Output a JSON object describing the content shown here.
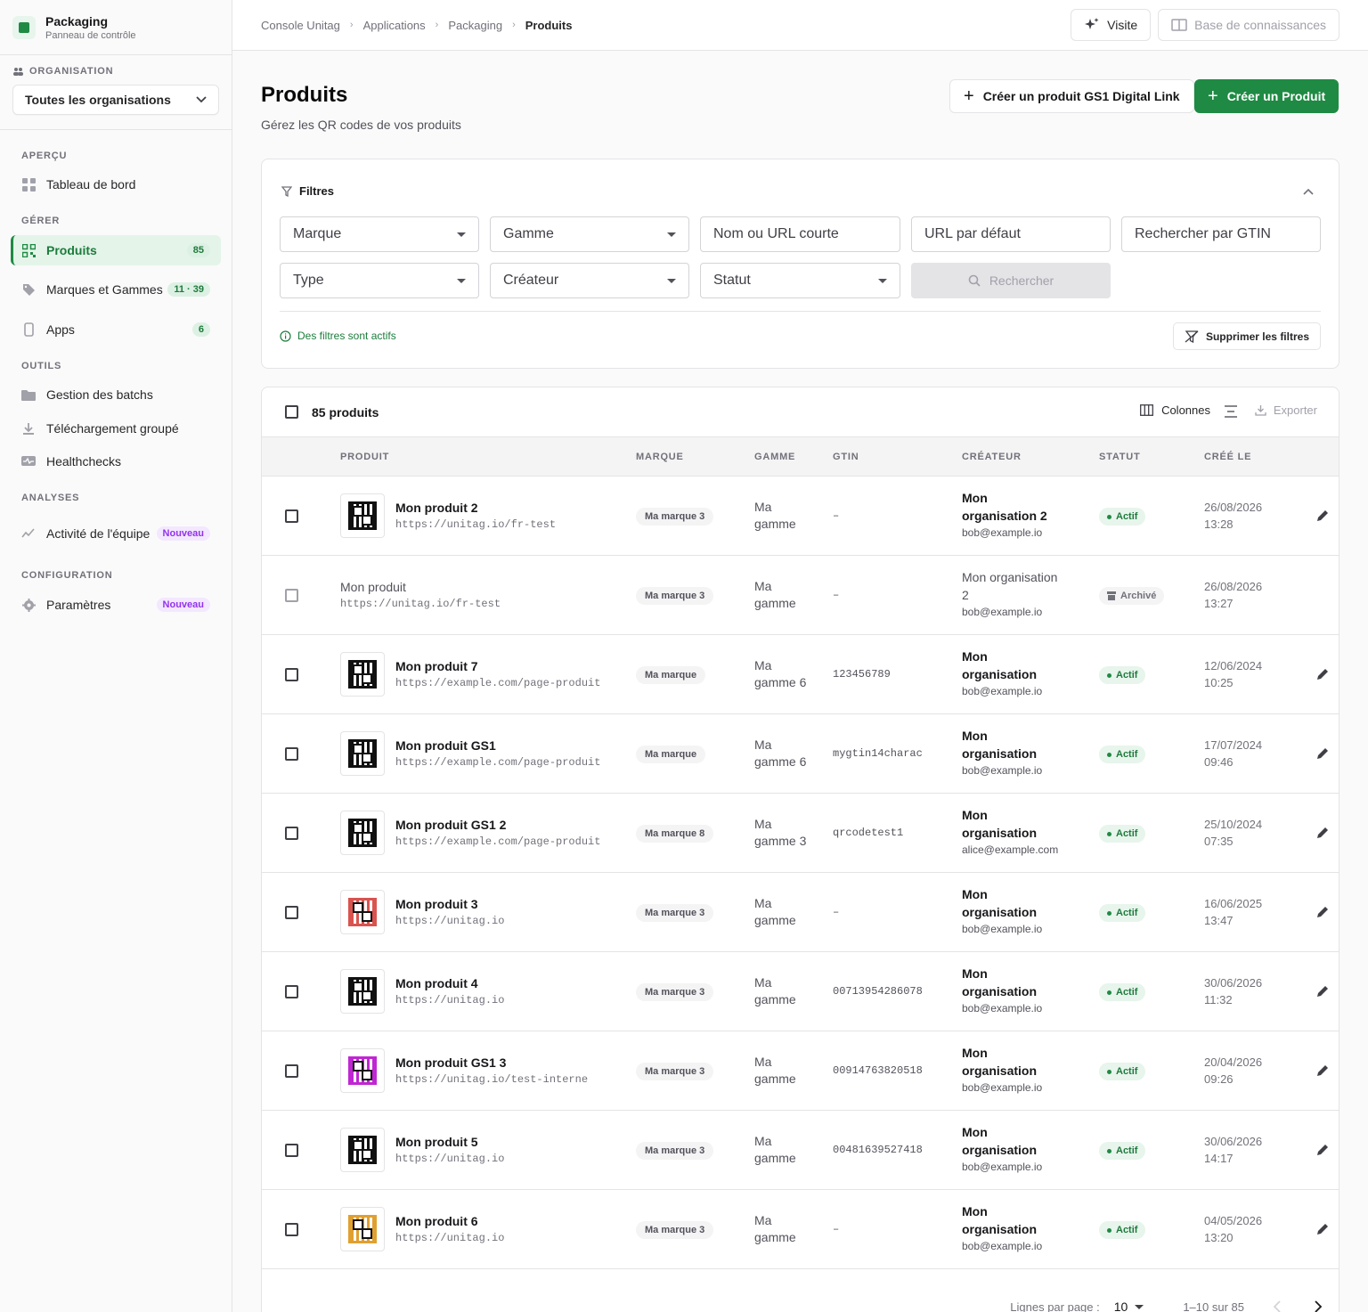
{
  "app": {
    "title": "Packaging",
    "subtitle": "Panneau de contrôle"
  },
  "organisation": {
    "label": "ORGANISATION",
    "selected": "Toutes les organisations"
  },
  "sidebar": {
    "sections": {
      "apercu": "APERÇU",
      "gerer": "GÉRER",
      "outils": "OUTILS",
      "analyses": "ANALYSES",
      "configuration": "CONFIGURATION"
    },
    "items": {
      "dashboard": {
        "label": "Tableau de bord"
      },
      "produits": {
        "label": "Produits",
        "badge": "85"
      },
      "marques": {
        "label": "Marques et Gammes",
        "badge": "11 · 39"
      },
      "apps": {
        "label": "Apps",
        "badge": "6"
      },
      "batchs": {
        "label": "Gestion des batchs"
      },
      "download": {
        "label": "Téléchargement groupé"
      },
      "health": {
        "label": "Healthchecks"
      },
      "activite": {
        "label": "Activité de l'équipe",
        "badge": "Nouveau"
      },
      "parametres": {
        "label": "Paramètres",
        "badge": "Nouveau"
      }
    }
  },
  "breadcrumb": [
    "Console Unitag",
    "Applications",
    "Packaging",
    "Produits"
  ],
  "topbar": {
    "visit": "Visite",
    "kb": "Base de connaissances"
  },
  "page": {
    "title": "Produits",
    "subtitle": "Gérez les QR codes de vos produits",
    "create_gs1": "Créer un produit GS1 Digital Link",
    "create": "Créer un Produit"
  },
  "filters": {
    "title": "Filtres",
    "marque": "Marque",
    "gamme": "Gamme",
    "nom": "Nom ou URL courte",
    "url": "URL par défaut",
    "gtin": "Rechercher par GTIN",
    "type": "Type",
    "createur": "Créateur",
    "statut": "Statut",
    "search": "Rechercher",
    "active_note": "Des filtres sont actifs",
    "clear": "Supprimer les filtres"
  },
  "table": {
    "count": "85 produits",
    "columns_btn": "Colonnes",
    "export_btn": "Exporter",
    "headers": {
      "produit": "PRODUIT",
      "marque": "MARQUE",
      "gamme": "GAMME",
      "gtin": "GTIN",
      "createur": "CRÉATEUR",
      "statut": "STATUT",
      "cree": "CRÉÉ LE"
    },
    "rows": [
      {
        "name": "Mon produit 2",
        "url": "https://unitag.io/fr-test",
        "brand": "Ma marque 3",
        "gamme": "Ma gamme",
        "gtin": "–",
        "creator": "Mon organisation 2",
        "email": "bob@example.io",
        "status": "Actif",
        "date": "26/08/2026 13:28",
        "qr_color": "#111111"
      },
      {
        "name": "Mon produit",
        "url": "https://unitag.io/fr-test",
        "brand": "Ma marque 3",
        "gamme": "Ma gamme",
        "gtin": "–",
        "creator": "Mon organisation 2",
        "email": "bob@example.io",
        "status": "Archivé",
        "date": "26/08/2026 13:27",
        "qr_color": ""
      },
      {
        "name": "Mon produit 7",
        "url": "https://example.com/page-produit",
        "brand": "Ma marque",
        "gamme": "Ma gamme 6",
        "gtin": "123456789",
        "creator": "Mon organisation",
        "email": "bob@example.io",
        "status": "Actif",
        "date": "12/06/2024 10:25",
        "qr_color": "#111111"
      },
      {
        "name": "Mon produit GS1",
        "url": "https://example.com/page-produit",
        "brand": "Ma marque",
        "gamme": "Ma gamme 6",
        "gtin": "mygtin14charac",
        "creator": "Mon organisation",
        "email": "bob@example.io",
        "status": "Actif",
        "date": "17/07/2024 09:46",
        "qr_color": "#111111"
      },
      {
        "name": "Mon produit GS1 2",
        "url": "https://example.com/page-produit",
        "brand": "Ma marque 8",
        "gamme": "Ma gamme 3",
        "gtin": "qrcodetest1",
        "creator": "Mon organisation",
        "email": "alice@example.com",
        "status": "Actif",
        "date": "25/10/2024 07:35",
        "qr_color": "#111111"
      },
      {
        "name": "Mon produit 3",
        "url": "https://unitag.io",
        "brand": "Ma marque 3",
        "gamme": "Ma gamme",
        "gtin": "–",
        "creator": "Mon organisation",
        "email": "bob@example.io",
        "status": "Actif",
        "date": "16/06/2025 13:47",
        "qr_color": "#d9534f"
      },
      {
        "name": "Mon produit 4",
        "url": "https://unitag.io",
        "brand": "Ma marque 3",
        "gamme": "Ma gamme",
        "gtin": "00713954286078",
        "creator": "Mon organisation",
        "email": "bob@example.io",
        "status": "Actif",
        "date": "30/06/2026 11:32",
        "qr_color": "#111111"
      },
      {
        "name": "Mon produit GS1 3",
        "url": "https://unitag.io/test-interne",
        "brand": "Ma marque 3",
        "gamme": "Ma gamme",
        "gtin": "00914763820518",
        "creator": "Mon organisation",
        "email": "bob@example.io",
        "status": "Actif",
        "date": "20/04/2026 09:26",
        "qr_color": "#c026d3"
      },
      {
        "name": "Mon produit 5",
        "url": "https://unitag.io",
        "brand": "Ma marque 3",
        "gamme": "Ma gamme",
        "gtin": "00481639527418",
        "creator": "Mon organisation",
        "email": "bob@example.io",
        "status": "Actif",
        "date": "30/06/2026 14:17",
        "qr_color": "#111111"
      },
      {
        "name": "Mon produit 6",
        "url": "https://unitag.io",
        "brand": "Ma marque 3",
        "gamme": "Ma gamme",
        "gtin": "–",
        "creator": "Mon organisation",
        "email": "bob@example.io",
        "status": "Actif",
        "date": "04/05/2026 13:20",
        "qr_color": "#e0a030"
      }
    ]
  },
  "pagination": {
    "rows_label": "Lignes par page :",
    "rows_value": "10",
    "range": "1–10 sur 85"
  },
  "colors": {
    "accent": "#1f8a43",
    "active_bg": "#e4f4e9"
  }
}
